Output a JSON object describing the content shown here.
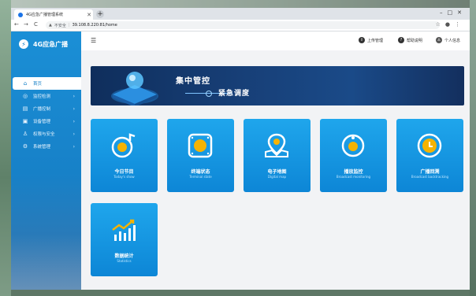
{
  "browser": {
    "tab_title": "4G应急广播管理系统",
    "address_insecure": "不安全",
    "url": "39.108.8.220:81/home"
  },
  "sidebar": {
    "logo_text": "4G应急广播",
    "items": [
      {
        "label": "首页",
        "icon": "home-icon",
        "active": true,
        "arrow": ""
      },
      {
        "label": "监控检测",
        "icon": "monitor-icon",
        "active": false,
        "arrow": "›"
      },
      {
        "label": "广播控制",
        "icon": "broadcast-icon",
        "active": false,
        "arrow": "›"
      },
      {
        "label": "设备管理",
        "icon": "device-icon",
        "active": false,
        "arrow": "›"
      },
      {
        "label": "权限与安全",
        "icon": "user-icon",
        "active": false,
        "arrow": "›"
      },
      {
        "label": "系统管理",
        "icon": "gear-icon",
        "active": false,
        "arrow": "›"
      }
    ]
  },
  "header": {
    "upload": "上传管理",
    "help": "帮助说明",
    "user": "个人信息"
  },
  "banner": {
    "title1": "集中管控",
    "title2": "紧急调度"
  },
  "cards": [
    {
      "name": "今日节目",
      "en": "Today's show",
      "icon": "music-note-icon"
    },
    {
      "name": "终端状态",
      "en": "Terminal state",
      "icon": "terminal-icon"
    },
    {
      "name": "电子地图",
      "en": "Digital map",
      "icon": "map-pin-icon"
    },
    {
      "name": "播放监控",
      "en": "Broadcast monitoring",
      "icon": "monitor-play-icon"
    },
    {
      "name": "广播回溯",
      "en": "Broadcast backtracking",
      "icon": "clock-icon"
    },
    {
      "name": "数据统计",
      "en": "Statistics",
      "icon": "chart-icon"
    }
  ],
  "colors": {
    "sidebar": "#1781c8",
    "card": "#1fa6ec",
    "accent": "#f5b301"
  }
}
